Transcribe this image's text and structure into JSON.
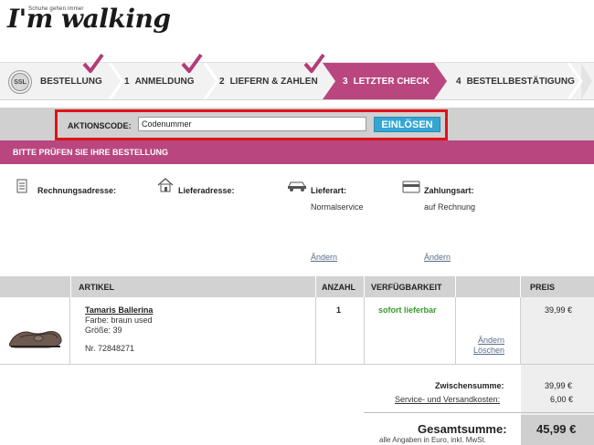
{
  "brand": {
    "tagline": "Schuhe gehen immer",
    "name": "I'm walking"
  },
  "steps": [
    {
      "num": "",
      "label": "BESTELLUNG",
      "done": true
    },
    {
      "num": "1",
      "label": "ANMELDUNG",
      "done": true
    },
    {
      "num": "2",
      "label": "LIEFERN & ZAHLEN",
      "done": true
    },
    {
      "num": "3",
      "label": "LETZTER CHECK",
      "active": true
    },
    {
      "num": "4",
      "label": "BESTELLBESTÄTIGUNG"
    }
  ],
  "ssl_badge": "SSL",
  "promo": {
    "label": "AKTIONSCODE:",
    "value": "Codenummer",
    "button": "EINLÖSEN"
  },
  "review_banner": "BITTE PRÜFEN SIE IHRE BESTELLUNG",
  "info": {
    "billing_label": "Rechnungsadresse:",
    "delivery_label": "Lieferadresse:",
    "shipping_label": "Lieferart:",
    "shipping_value": "Normalservice",
    "shipping_change": "Ändern",
    "payment_label": "Zahlungsart:",
    "payment_value": "auf Rechnung",
    "payment_change": "Ändern"
  },
  "table": {
    "headers": {
      "article": "ARTIKEL",
      "quantity": "ANZAHL",
      "availability": "VERFÜGBARKEIT",
      "price": "PREIS"
    },
    "rows": [
      {
        "name": "Tamaris Ballerina",
        "color": "Farbe: braun used",
        "size": "Größe: 39",
        "number": "Nr. 72848271",
        "quantity": "1",
        "availability": "sofort lieferbar",
        "edit": "Ändern",
        "delete": "Löschen",
        "price": "39,99 €"
      }
    ]
  },
  "totals": {
    "subtotal_label": "Zwischensumme:",
    "subtotal_value": "39,99 €",
    "shipping_label": "Service- und Versandkosten:",
    "shipping_value": "6,00 €",
    "total_label": "Gesamtsumme:",
    "total_note": "alle Angaben in Euro, inkl. MwSt.",
    "total_value": "45,99 €"
  },
  "colors": {
    "accent_pink": "#b9467f",
    "checkmark": "#b23c78",
    "button_blue": "#33a6d4",
    "highlight_red": "#e0121a",
    "available_green": "#3a9a2e"
  }
}
